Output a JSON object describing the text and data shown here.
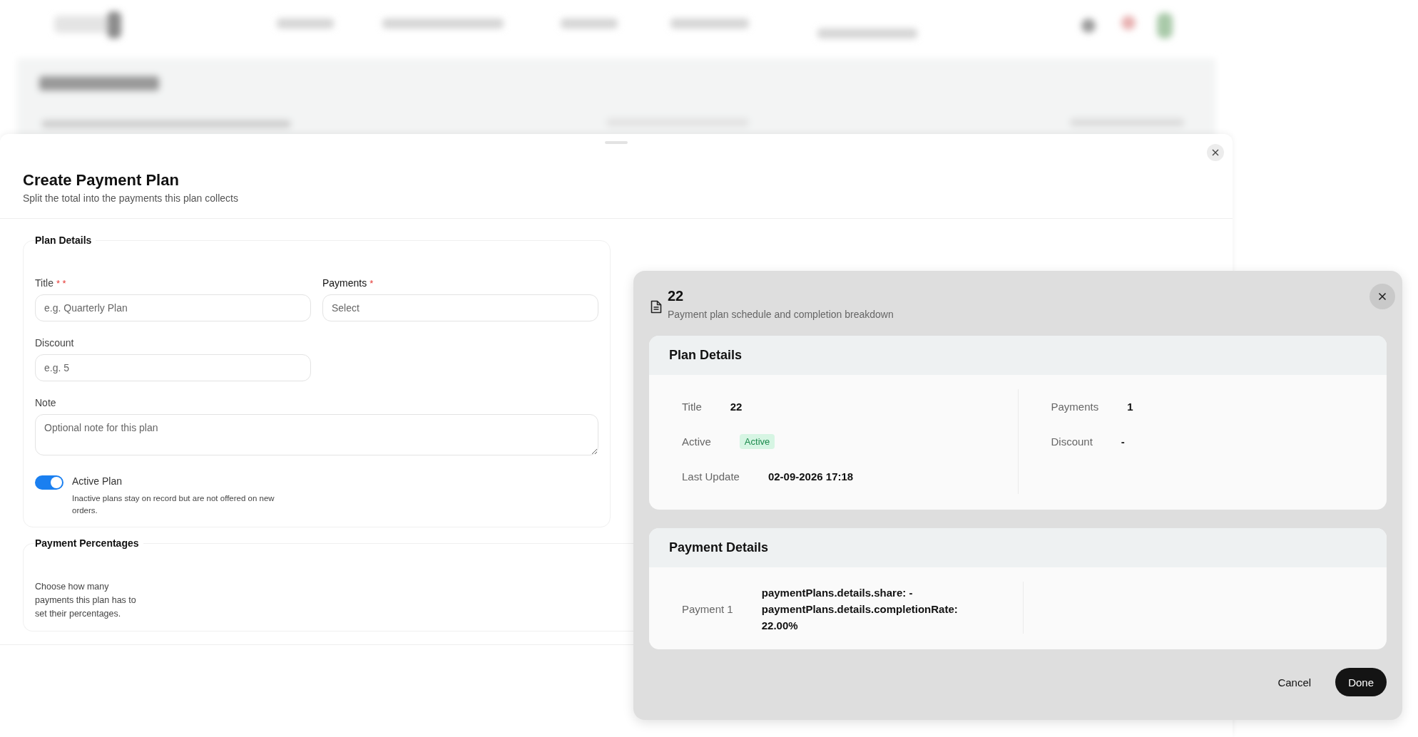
{
  "sheet": {
    "title": "Create Payment Plan",
    "subtitle": "Split the total into the payments this plan collects"
  },
  "plan_details": {
    "heading": "Plan Details",
    "fields": [
      {
        "kind": "text",
        "label": "Title",
        "required_mark": "* *",
        "placeholder": "e.g. Quarterly Plan"
      },
      {
        "kind": "select",
        "label": "Payments",
        "required_mark": "*",
        "placeholder": "Select"
      },
      {
        "kind": "text",
        "label": "Discount",
        "placeholder": "e.g. 5"
      },
      {
        "kind": "textarea",
        "label": "Note",
        "placeholder": "Optional note for this plan"
      }
    ],
    "toggle": {
      "label": "Active Plan",
      "description": "Inactive plans stay on record but are not offered on new orders.",
      "on": true
    }
  },
  "payment_percentages": {
    "heading": "Payment Percentages",
    "text": "Choose how many payments this plan has to set their percentages."
  },
  "dialog": {
    "title": "22",
    "subtitle": "Payment plan schedule and completion breakdown",
    "plan_card": {
      "heading": "Plan Details",
      "left": [
        {
          "label": "Title",
          "value": "22",
          "kind": "text"
        },
        {
          "label": "Active",
          "value": "Active",
          "kind": "badge"
        },
        {
          "label": "Last Update",
          "value": "02-09-2026 17:18",
          "kind": "text"
        }
      ],
      "right": [
        {
          "label": "Payments",
          "value": "1",
          "kind": "text"
        },
        {
          "label": "Discount",
          "value": "-",
          "kind": "text"
        }
      ]
    },
    "payment_card": {
      "heading": "Payment Details",
      "rows": [
        {
          "label": "Payment 1",
          "value": "paymentPlans.details.share: - paymentPlans.details.completionRate: 22.00%"
        }
      ]
    },
    "buttons": [
      {
        "label": "Cancel",
        "kind": "plain"
      },
      {
        "label": "Done",
        "kind": "primary"
      }
    ]
  }
}
